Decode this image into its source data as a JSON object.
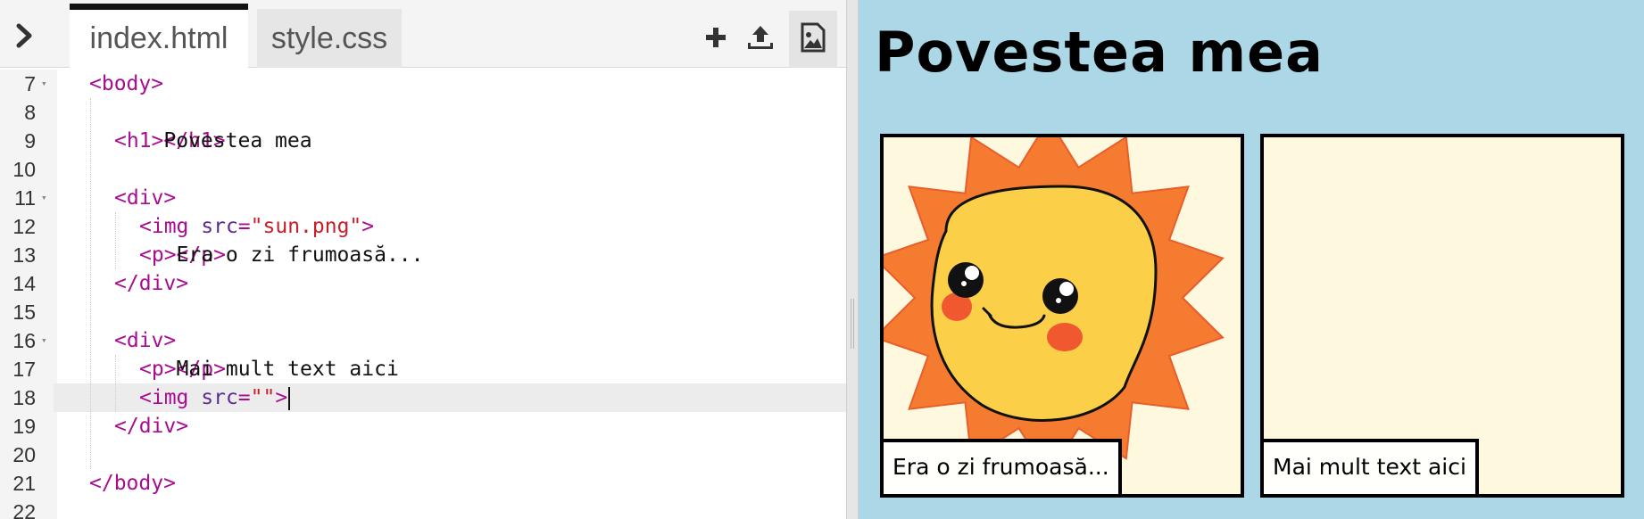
{
  "editor": {
    "tabs": [
      {
        "label": "index.html",
        "active": true
      },
      {
        "label": "style.css",
        "active": false
      }
    ],
    "tools": [
      "plus-icon",
      "upload-icon",
      "image-icon"
    ],
    "lines": [
      {
        "num": "7",
        "fold": true,
        "indent": 1,
        "parts": [
          [
            "tag",
            "<body>"
          ]
        ]
      },
      {
        "num": "8",
        "indent": 0,
        "parts": []
      },
      {
        "num": "9",
        "indent": 2,
        "parts": [
          [
            "tag",
            "<h1>"
          ],
          [
            "txt",
            "Povestea mea"
          ],
          [
            "tag",
            "</h1>"
          ]
        ]
      },
      {
        "num": "10",
        "indent": 0,
        "parts": []
      },
      {
        "num": "11",
        "fold": true,
        "indent": 2,
        "parts": [
          [
            "tag",
            "<div>"
          ]
        ]
      },
      {
        "num": "12",
        "indent": 3,
        "parts": [
          [
            "tag",
            "<img "
          ],
          [
            "attr",
            "src"
          ],
          [
            "tag",
            "="
          ],
          [
            "str",
            "\"sun.png\""
          ],
          [
            "tag",
            ">"
          ]
        ]
      },
      {
        "num": "13",
        "indent": 3,
        "parts": [
          [
            "tag",
            "<p>"
          ],
          [
            "txt",
            "Era o zi frumoasă..."
          ],
          [
            "tag",
            "</p>"
          ]
        ]
      },
      {
        "num": "14",
        "indent": 2,
        "parts": [
          [
            "tag",
            "</div>"
          ]
        ]
      },
      {
        "num": "15",
        "indent": 0,
        "parts": []
      },
      {
        "num": "16",
        "fold": true,
        "indent": 2,
        "parts": [
          [
            "tag",
            "<div>"
          ]
        ]
      },
      {
        "num": "17",
        "indent": 3,
        "parts": [
          [
            "tag",
            "<p>"
          ],
          [
            "txt",
            "Mai mult text aici"
          ],
          [
            "tag",
            "</p>"
          ]
        ]
      },
      {
        "num": "18",
        "indent": 3,
        "active": true,
        "cursor": true,
        "parts": [
          [
            "tag",
            "<img "
          ],
          [
            "attr",
            "src"
          ],
          [
            "tag",
            "="
          ],
          [
            "str",
            "\"\""
          ],
          [
            "tag",
            ">"
          ]
        ]
      },
      {
        "num": "19",
        "indent": 2,
        "parts": [
          [
            "tag",
            "</div>"
          ]
        ]
      },
      {
        "num": "20",
        "indent": 0,
        "parts": []
      },
      {
        "num": "21",
        "indent": 1,
        "parts": [
          [
            "tag",
            "</body>"
          ]
        ]
      },
      {
        "num": "22",
        "indent": 0,
        "parts": []
      }
    ]
  },
  "preview": {
    "title": "Povestea mea",
    "panels": [
      {
        "image": "sun-illustration",
        "caption": "Era o zi frumoasă..."
      },
      {
        "image": "",
        "caption": "Mai mult text aici"
      }
    ],
    "colors": {
      "background": "#acd7e6",
      "panel": "#fef8df",
      "sun_rays": "#f47b30",
      "sun_face": "#fbcf47",
      "cheeks": "#ee4a2e"
    }
  }
}
